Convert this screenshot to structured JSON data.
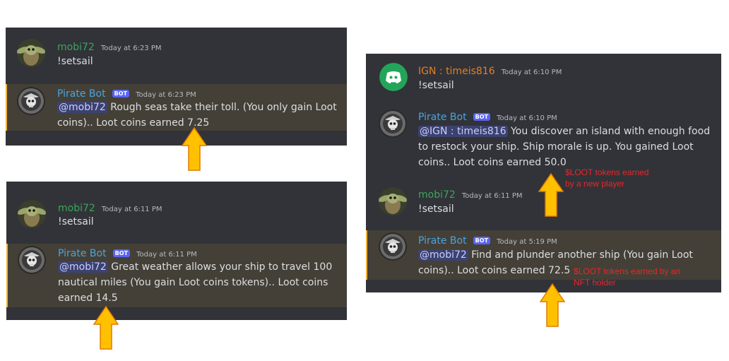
{
  "colors": {
    "panel_bg": "#313338",
    "highlight_bg": "#444037",
    "highlight_border": "#f0b232",
    "user_green": "#3ba55d",
    "bot_blue": "#4aa3df",
    "ign_orange": "#e67e22",
    "annotation_red": "#e8262a",
    "arrow_fill": "#ffc000"
  },
  "panel1": {
    "user_msg": {
      "username": "mobi72",
      "timestamp": "Today at 6:23 PM",
      "text": "!setsail",
      "avatar": "baby-yoda-avatar"
    },
    "bot_msg": {
      "username": "Pirate Bot",
      "badge": "BOT",
      "timestamp": "Today at 6:23 PM",
      "avatar": "pirate-skull-avatar",
      "mention": "@mobi72",
      "line1": " Rough seas take their toll. (You only gain Loot",
      "line2": "coins).. Loot coins earned 7.25"
    }
  },
  "panel2": {
    "user_msg": {
      "username": "mobi72",
      "timestamp": "Today at 6:11 PM",
      "text": "!setsail",
      "avatar": "baby-yoda-avatar"
    },
    "bot_msg": {
      "username": "Pirate Bot",
      "badge": "BOT",
      "timestamp": "Today at 6:11 PM",
      "avatar": "pirate-skull-avatar",
      "mention": "@mobi72",
      "line1": " Great weather allows your ship to travel 100",
      "line2": "nautical miles (You gain Loot coins tokens).. Loot coins",
      "line3": "earned 14.5"
    }
  },
  "panel3": {
    "ign_msg": {
      "username": "IGN : timeis816",
      "timestamp": "Today at 6:10 PM",
      "text": "!setsail",
      "avatar": "discord-logo-avatar"
    },
    "bot_msg1": {
      "username": "Pirate Bot",
      "badge": "BOT",
      "timestamp": "Today at 6:10 PM",
      "avatar": "pirate-skull-avatar",
      "mention": "@IGN : timeis816",
      "line1": " You discover an island with enough food",
      "line2": "to restock your ship. Ship morale is up. You gained Loot",
      "line3": "coins.. Loot coins earned 50.0"
    },
    "user_msg": {
      "username": "mobi72",
      "timestamp": "Today at 6:11 PM",
      "text": "!setsail",
      "avatar": "baby-yoda-avatar"
    },
    "bot_msg2": {
      "username": "Pirate Bot",
      "badge": "BOT",
      "timestamp": "Today at 5:19 PM",
      "avatar": "pirate-skull-avatar",
      "mention": "@mobi72",
      "line1": " Find and plunder another ship (You gain Loot",
      "line2": "coins).. Loot coins earned 72.5"
    }
  },
  "annotations": {
    "new_player_line1": "$LOOT tokens earned",
    "new_player_line2": "by a new player",
    "nft_holder_line1": "$LOOT tokens earned by an",
    "nft_holder_line2": "NFT holder"
  }
}
